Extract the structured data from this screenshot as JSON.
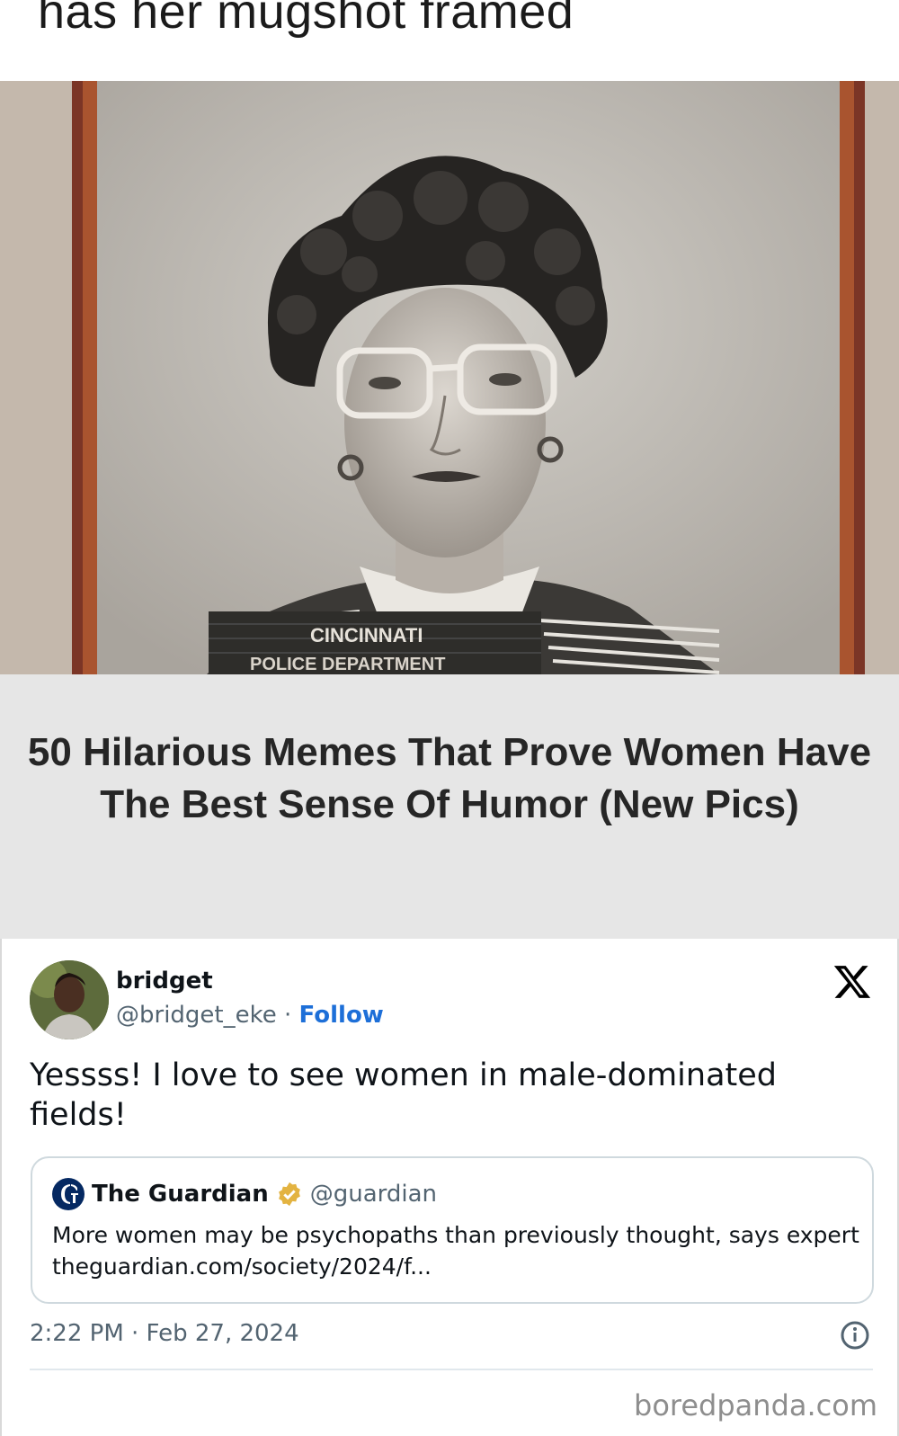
{
  "caption": {
    "text": "has her mugshot framed"
  },
  "photo": {
    "placard_line1": "CINCINNATI",
    "placard_line2": "POLICE DEPARTMENT"
  },
  "article": {
    "title": "50 Hilarious Memes That Prove Women Have The Best Sense Of Humor (New Pics)"
  },
  "tweet": {
    "name": "bridget",
    "handle": "@bridget_eke",
    "separator": " · ",
    "follow_label": "Follow",
    "text": "Yessss! I love to see women in male-dominated fields!",
    "quote": {
      "name": "The Guardian",
      "handle": "@guardian",
      "text": "More women may be psychopaths than previously thought, says expert theguardian.com/society/2024/f..."
    },
    "timestamp": "2:22 PM · Feb 27, 2024"
  },
  "watermark": "boredpanda.com",
  "colors": {
    "follow": "#1d6fd8",
    "badge": "#e3b341",
    "band": "#e6e6e6"
  },
  "icons": [
    "x-logo-icon",
    "guardian-logo-icon",
    "verified-badge-icon",
    "info-icon"
  ]
}
